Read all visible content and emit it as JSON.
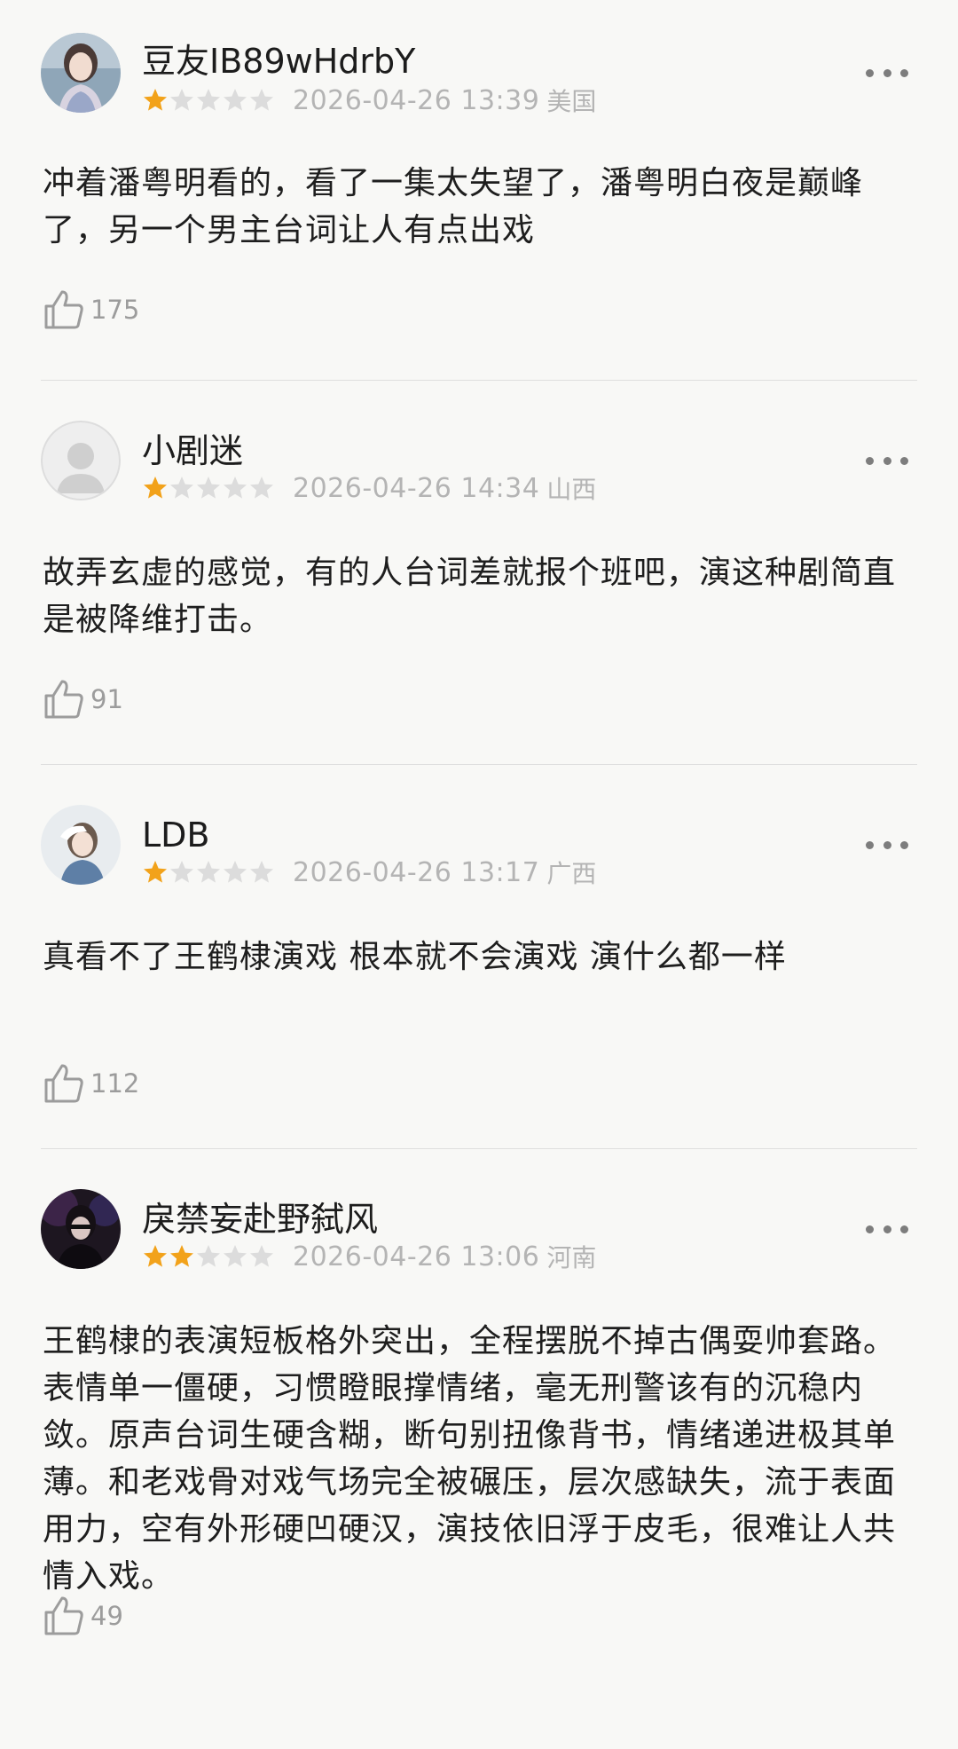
{
  "colors": {
    "star_filled": "#f2a21a",
    "star_empty": "#dcdcdc",
    "text": "#1e1e1e",
    "muted": "#b4b4b4",
    "divider": "#dedede",
    "background": "#f8f8f6"
  },
  "reviews": [
    {
      "username": "豆友IB89wHdrbY",
      "rating": 1,
      "rating_max": 5,
      "timestamp": "2026-04-26 13:39",
      "location": "美国",
      "text": "冲着潘粤明看的，看了一集太失望了，潘粤明白夜是巅峰了，另一个男主台词让人有点出戏",
      "likes": "175",
      "avatar_icon": "user-photo-avatar",
      "more_icon": "more-options-icon",
      "like_icon": "thumbs-up-icon"
    },
    {
      "username": "小剧迷",
      "rating": 1,
      "rating_max": 5,
      "timestamp": "2026-04-26 14:34",
      "location": "山西",
      "text": "故弄玄虚的感觉，有的人台词差就报个班吧，演这种剧简直是被降维打击。",
      "likes": "91",
      "avatar_icon": "default-user-avatar",
      "more_icon": "more-options-icon",
      "like_icon": "thumbs-up-icon"
    },
    {
      "username": "LDB",
      "rating": 1,
      "rating_max": 5,
      "timestamp": "2026-04-26 13:17",
      "location": "广西",
      "text": "真看不了王鹤棣演戏 根本就不会演戏 演什么都一样",
      "likes": "112",
      "avatar_icon": "user-photo-avatar",
      "more_icon": "more-options-icon",
      "like_icon": "thumbs-up-icon"
    },
    {
      "username": "戾禁妄赴野弑风",
      "rating": 2,
      "rating_max": 5,
      "timestamp": "2026-04-26 13:06",
      "location": "河南",
      "text": "王鹤棣的表演短板格外突出，全程摆脱不掉古偶耍帅套路。表情单一僵硬，习惯瞪眼撑情绪，毫无刑警该有的沉稳内敛。原声台词生硬含糊，断句别扭像背书，情绪递进极其单薄。和老戏骨对戏气场完全被碾压，层次感缺失，流于表面用力，空有外形硬凹硬汉，演技依旧浮于皮毛，很难让人共情入戏。",
      "likes": "49",
      "avatar_icon": "user-photo-avatar",
      "more_icon": "more-options-icon",
      "like_icon": "thumbs-up-icon"
    }
  ]
}
